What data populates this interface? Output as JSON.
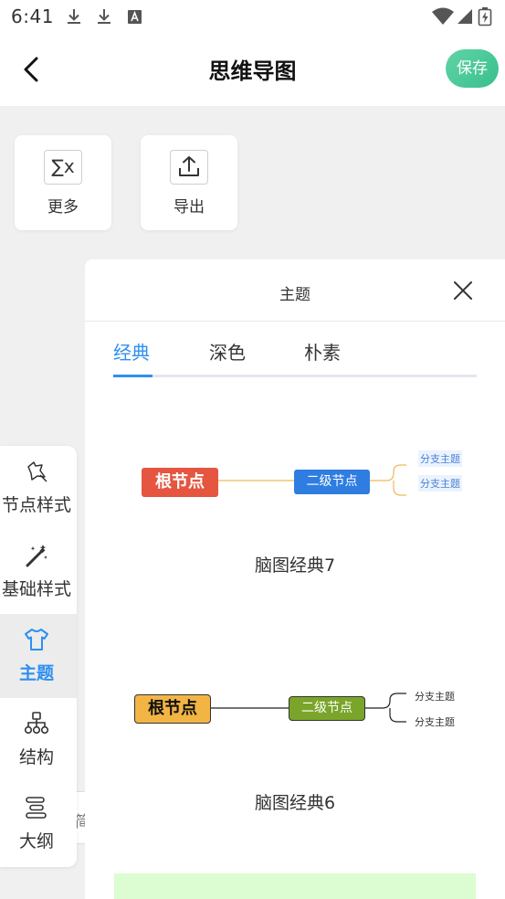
{
  "status_bar": {
    "time": "6:41",
    "icons": [
      "download-icon",
      "download-icon",
      "font-icon",
      "wifi-icon",
      "signal-icon",
      "battery-charging-icon"
    ]
  },
  "header": {
    "title": "思维导图",
    "back_icon": "chevron-left-icon",
    "save_label": "保存"
  },
  "toolbar": {
    "items": [
      {
        "label": "更多",
        "icon": "formula-icon",
        "icon_text": "∑x"
      },
      {
        "label": "导出",
        "icon": "export-icon"
      }
    ]
  },
  "background_note": {
    "text": "简"
  },
  "side_nav": {
    "items": [
      {
        "label": "节点样式",
        "icon": "node-style-icon",
        "active": false
      },
      {
        "label": "基础样式",
        "icon": "magic-wand-icon",
        "active": false
      },
      {
        "label": "主题",
        "icon": "shirt-icon",
        "active": true
      },
      {
        "label": "结构",
        "icon": "structure-icon",
        "active": false
      },
      {
        "label": "大纲",
        "icon": "outline-icon",
        "active": false
      }
    ],
    "active_color": "#2f8ff0"
  },
  "theme_panel": {
    "title": "主题",
    "close_icon": "close-icon",
    "tabs": [
      {
        "label": "经典",
        "active": true
      },
      {
        "label": "深色",
        "active": false
      },
      {
        "label": "朴素",
        "active": false
      }
    ],
    "themes": [
      {
        "name": "脑图经典7",
        "root": {
          "label": "根节点",
          "color": "#e5553f"
        },
        "second": {
          "label": "二级节点",
          "color": "#2f7de1"
        },
        "line_color": "#f0b85a",
        "leaves": [
          "分支主题",
          "分支主题"
        ],
        "leaf_bg": "#eaf3fe",
        "leaf_color": "#4a7fd4"
      },
      {
        "name": "脑图经典6",
        "root": {
          "label": "根节点",
          "color": "#f2b544"
        },
        "second": {
          "label": "二级节点",
          "color": "#7aa52a"
        },
        "line_color": "#222222",
        "leaves": [
          "分支主题",
          "分支主题"
        ],
        "leaf_bg": "#ffffff",
        "leaf_color": "#333333"
      }
    ],
    "next_swatch_color": "#dcfcd2"
  }
}
